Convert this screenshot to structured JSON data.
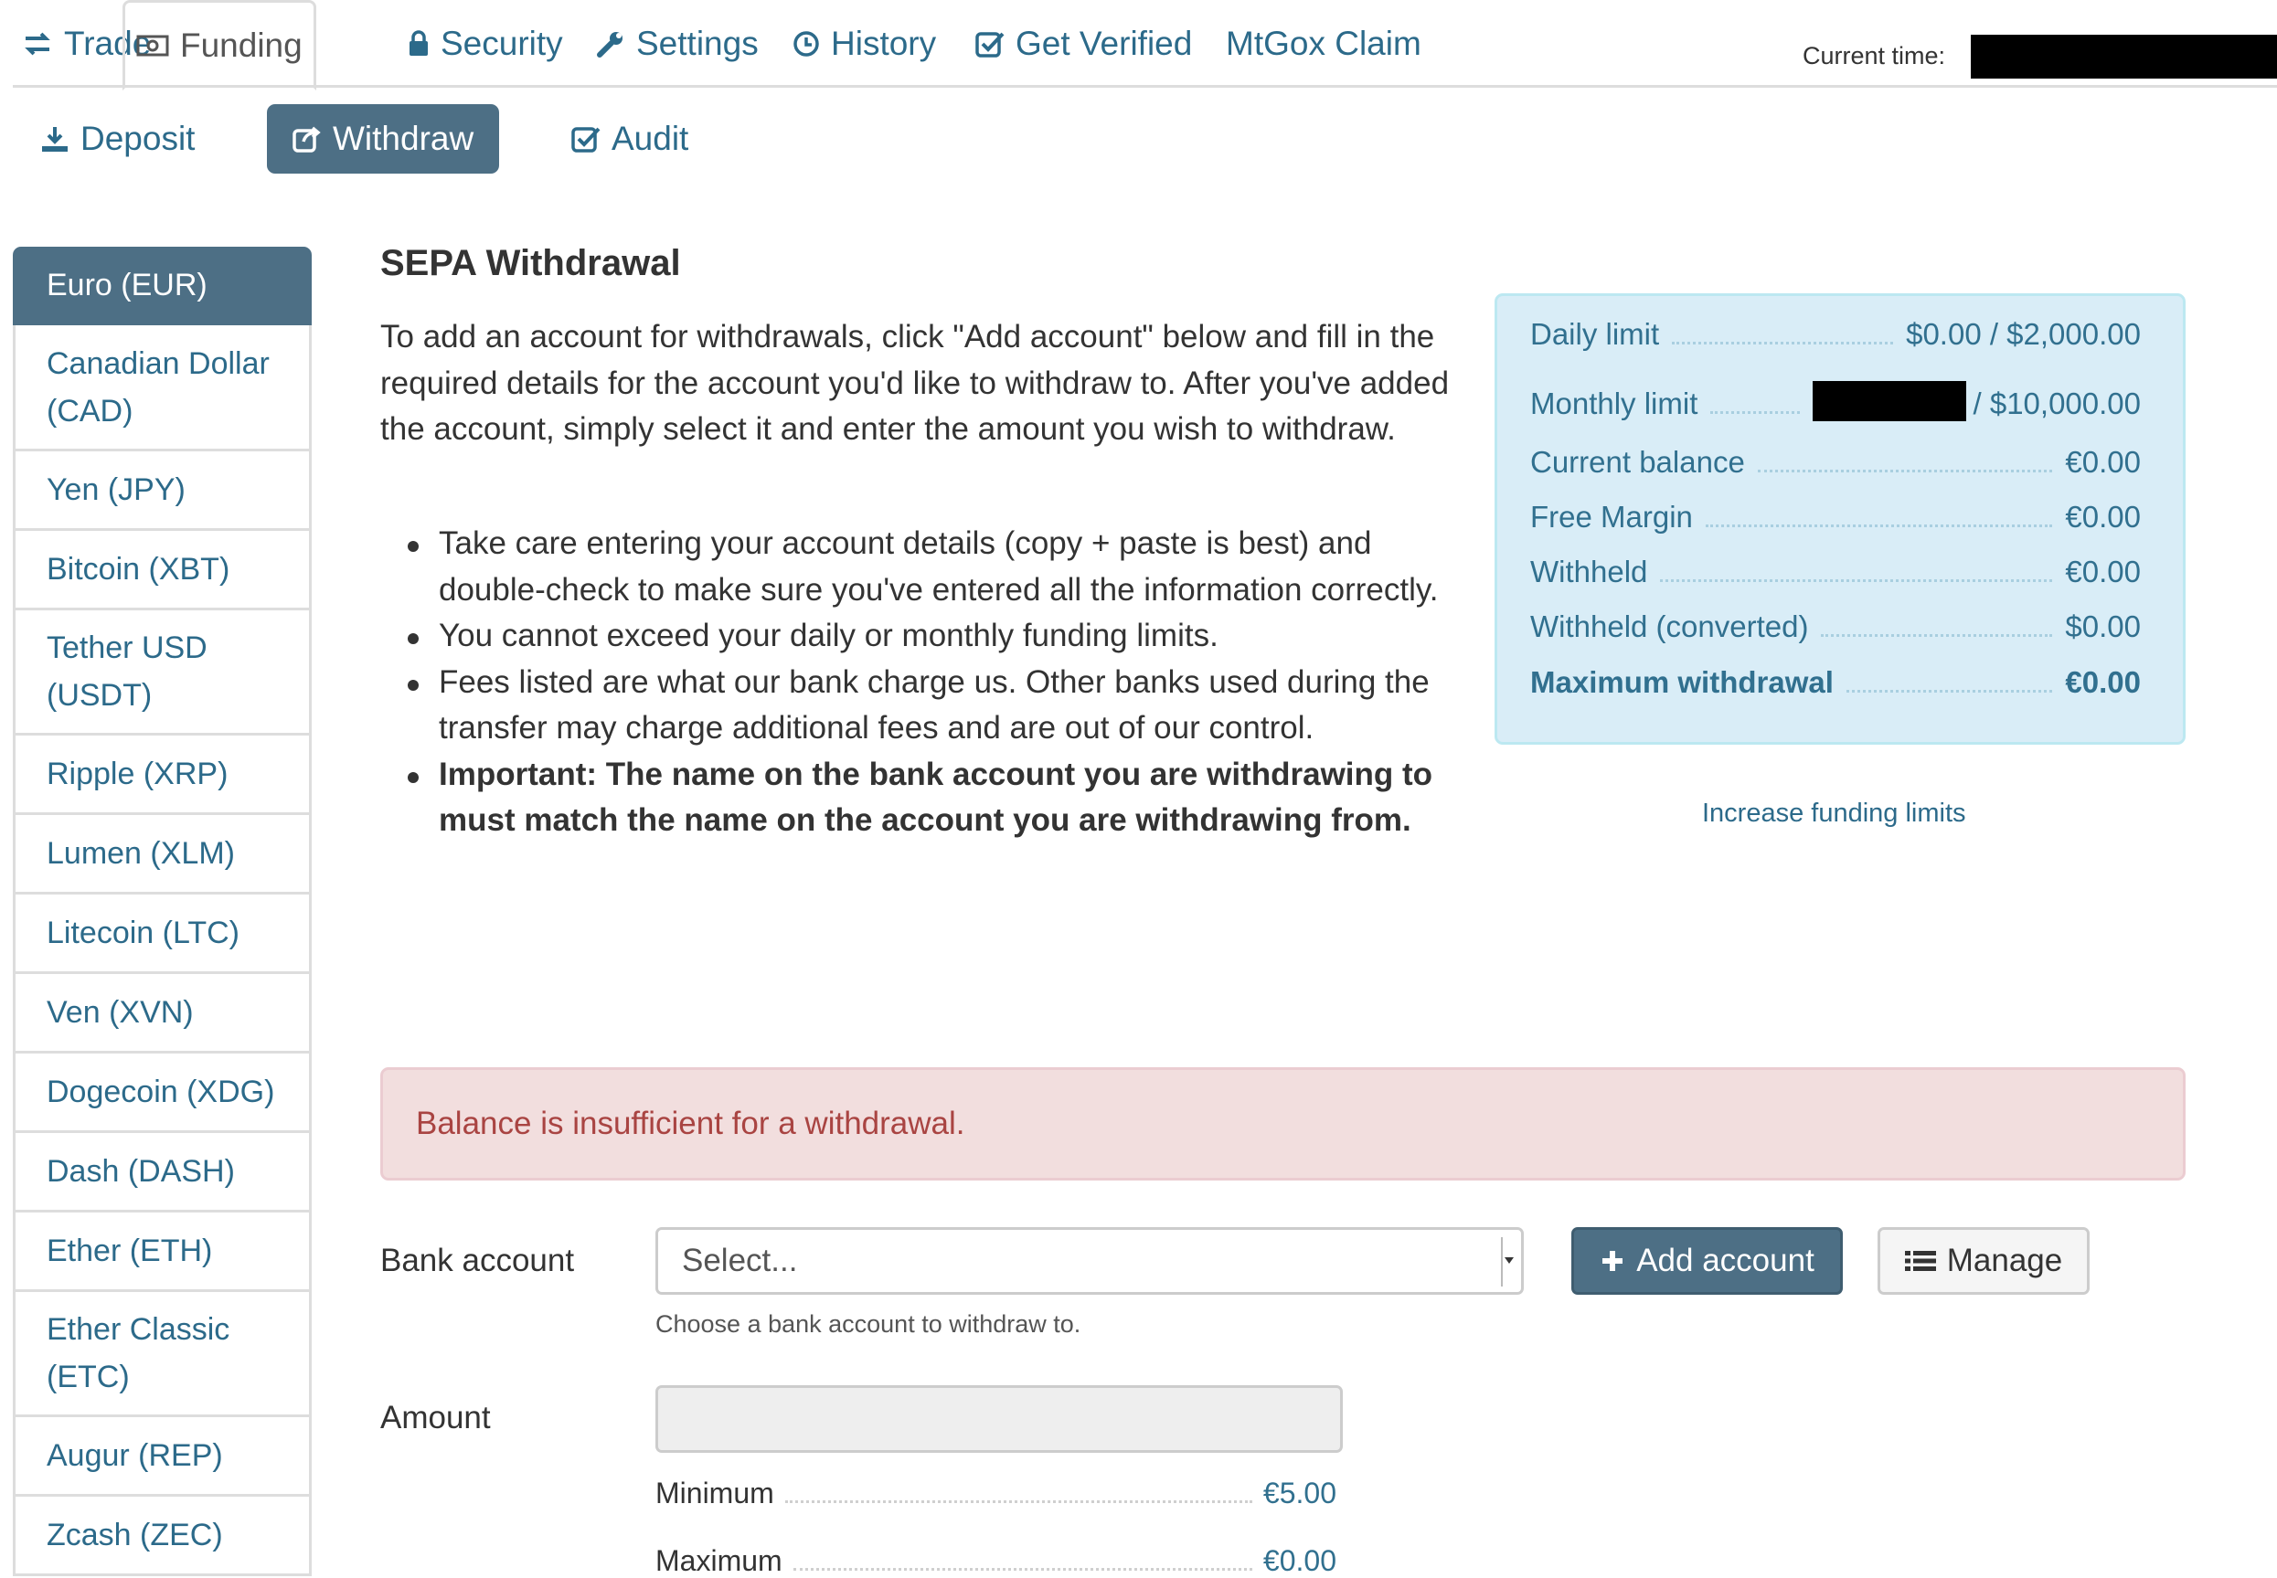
{
  "topnav": {
    "tabs": [
      {
        "label": "Trade",
        "icon": "exchange-icon"
      },
      {
        "label": "Funding",
        "icon": "money-icon",
        "active": true
      },
      {
        "label": "Security",
        "icon": "lock-icon"
      },
      {
        "label": "Settings",
        "icon": "wrench-icon"
      },
      {
        "label": "History",
        "icon": "clock-icon"
      },
      {
        "label": "Get Verified",
        "icon": "check-square-icon"
      },
      {
        "label": "MtGox Claim",
        "icon": ""
      }
    ],
    "current_time_label": "Current time:"
  },
  "subnav": {
    "items": [
      {
        "label": "Deposit",
        "icon": "download-icon"
      },
      {
        "label": "Withdraw",
        "icon": "share-icon",
        "active": true
      },
      {
        "label": "Audit",
        "icon": "check-square-icon"
      }
    ]
  },
  "sidebar": {
    "currencies": [
      {
        "label": "Euro (EUR)",
        "active": true
      },
      {
        "label": "Canadian Dollar (CAD)"
      },
      {
        "label": "Yen (JPY)"
      },
      {
        "label": "Bitcoin (XBT)"
      },
      {
        "label": "Tether USD (USDT)"
      },
      {
        "label": "Ripple (XRP)"
      },
      {
        "label": "Lumen (XLM)"
      },
      {
        "label": "Litecoin (LTC)"
      },
      {
        "label": "Ven (XVN)"
      },
      {
        "label": "Dogecoin (XDG)"
      },
      {
        "label": "Dash (DASH)"
      },
      {
        "label": "Ether (ETH)"
      },
      {
        "label": "Ether Classic (ETC)"
      },
      {
        "label": "Augur (REP)"
      },
      {
        "label": "Zcash (ZEC)"
      }
    ]
  },
  "main": {
    "title": "SEPA Withdrawal",
    "intro": "To add an account for withdrawals, click \"Add account\" below and fill in the required details for the account you'd like to withdraw to. After you've added the account, simply select it and enter the amount you wish to withdraw.",
    "bullets": [
      "Take care entering your account details (copy + paste is best) and double-check to make sure you've entered all the information correctly.",
      "You cannot exceed your daily or monthly funding limits.",
      "Fees listed are what our bank charge us. Other banks used during the transfer may charge additional fees and are out of our control.",
      "Important: The name on the bank account you are withdrawing to must match the name on the account you are withdrawing from."
    ],
    "limits": {
      "daily_limit": {
        "label": "Daily limit",
        "value": "$0.00 / $2,000.00"
      },
      "monthly_limit": {
        "label": "Monthly limit",
        "value": "/ $10,000.00"
      },
      "current_balance": {
        "label": "Current balance",
        "value": "€0.00"
      },
      "free_margin": {
        "label": "Free Margin",
        "value": "€0.00"
      },
      "withheld": {
        "label": "Withheld",
        "value": "€0.00"
      },
      "withheld_converted": {
        "label": "Withheld (converted)",
        "value": "$0.00"
      },
      "max_withdrawal": {
        "label": "Maximum withdrawal",
        "value": "€0.00"
      }
    },
    "increase_limits_link": "Increase funding limits",
    "alert": "Balance is insufficient for a withdrawal.",
    "form": {
      "bank_account_label": "Bank account",
      "select_value": "Select...",
      "help_text": "Choose a bank account to withdraw to.",
      "add_account_label": "Add account",
      "manage_label": "Manage",
      "amount_label": "Amount",
      "amount_value": "",
      "minimum": {
        "label": "Minimum",
        "value": "€5.00"
      },
      "maximum": {
        "label": "Maximum",
        "value": "€0.00"
      }
    }
  },
  "colors": {
    "accent": "#4d6f85",
    "link": "#2c6a8a",
    "info_bg": "#d9edf7",
    "info_text": "#31708f",
    "danger_bg": "#f2dede",
    "danger_text": "#a94442"
  }
}
